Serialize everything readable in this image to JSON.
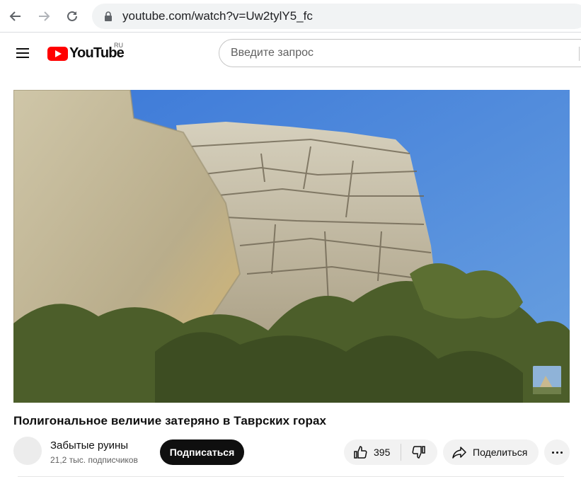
{
  "browser": {
    "url": "youtube.com/watch?v=Uw2tylY5_fc"
  },
  "header": {
    "logo_text": "YouTube",
    "region": "RU",
    "search_placeholder": "Введите запрос"
  },
  "video": {
    "title": "Полигональное величие затеряно в Таврских горах"
  },
  "channel": {
    "name": "Забытые руины",
    "subscribers": "21,2 тыс. подписчиков",
    "subscribe_label": "Подписаться"
  },
  "actions": {
    "like_count": "395",
    "share_label": "Поделиться"
  },
  "colors": {
    "brand_red": "#ff0000",
    "subscribe_bg": "#0f0f0f",
    "chip_bg": "#f2f2f2"
  },
  "icons": [
    "back-arrow-icon",
    "forward-arrow-icon",
    "reload-icon",
    "lock-icon",
    "menu-icon",
    "youtube-logo-icon",
    "thumbs-up-icon",
    "thumbs-down-icon",
    "share-icon",
    "more-icon"
  ]
}
